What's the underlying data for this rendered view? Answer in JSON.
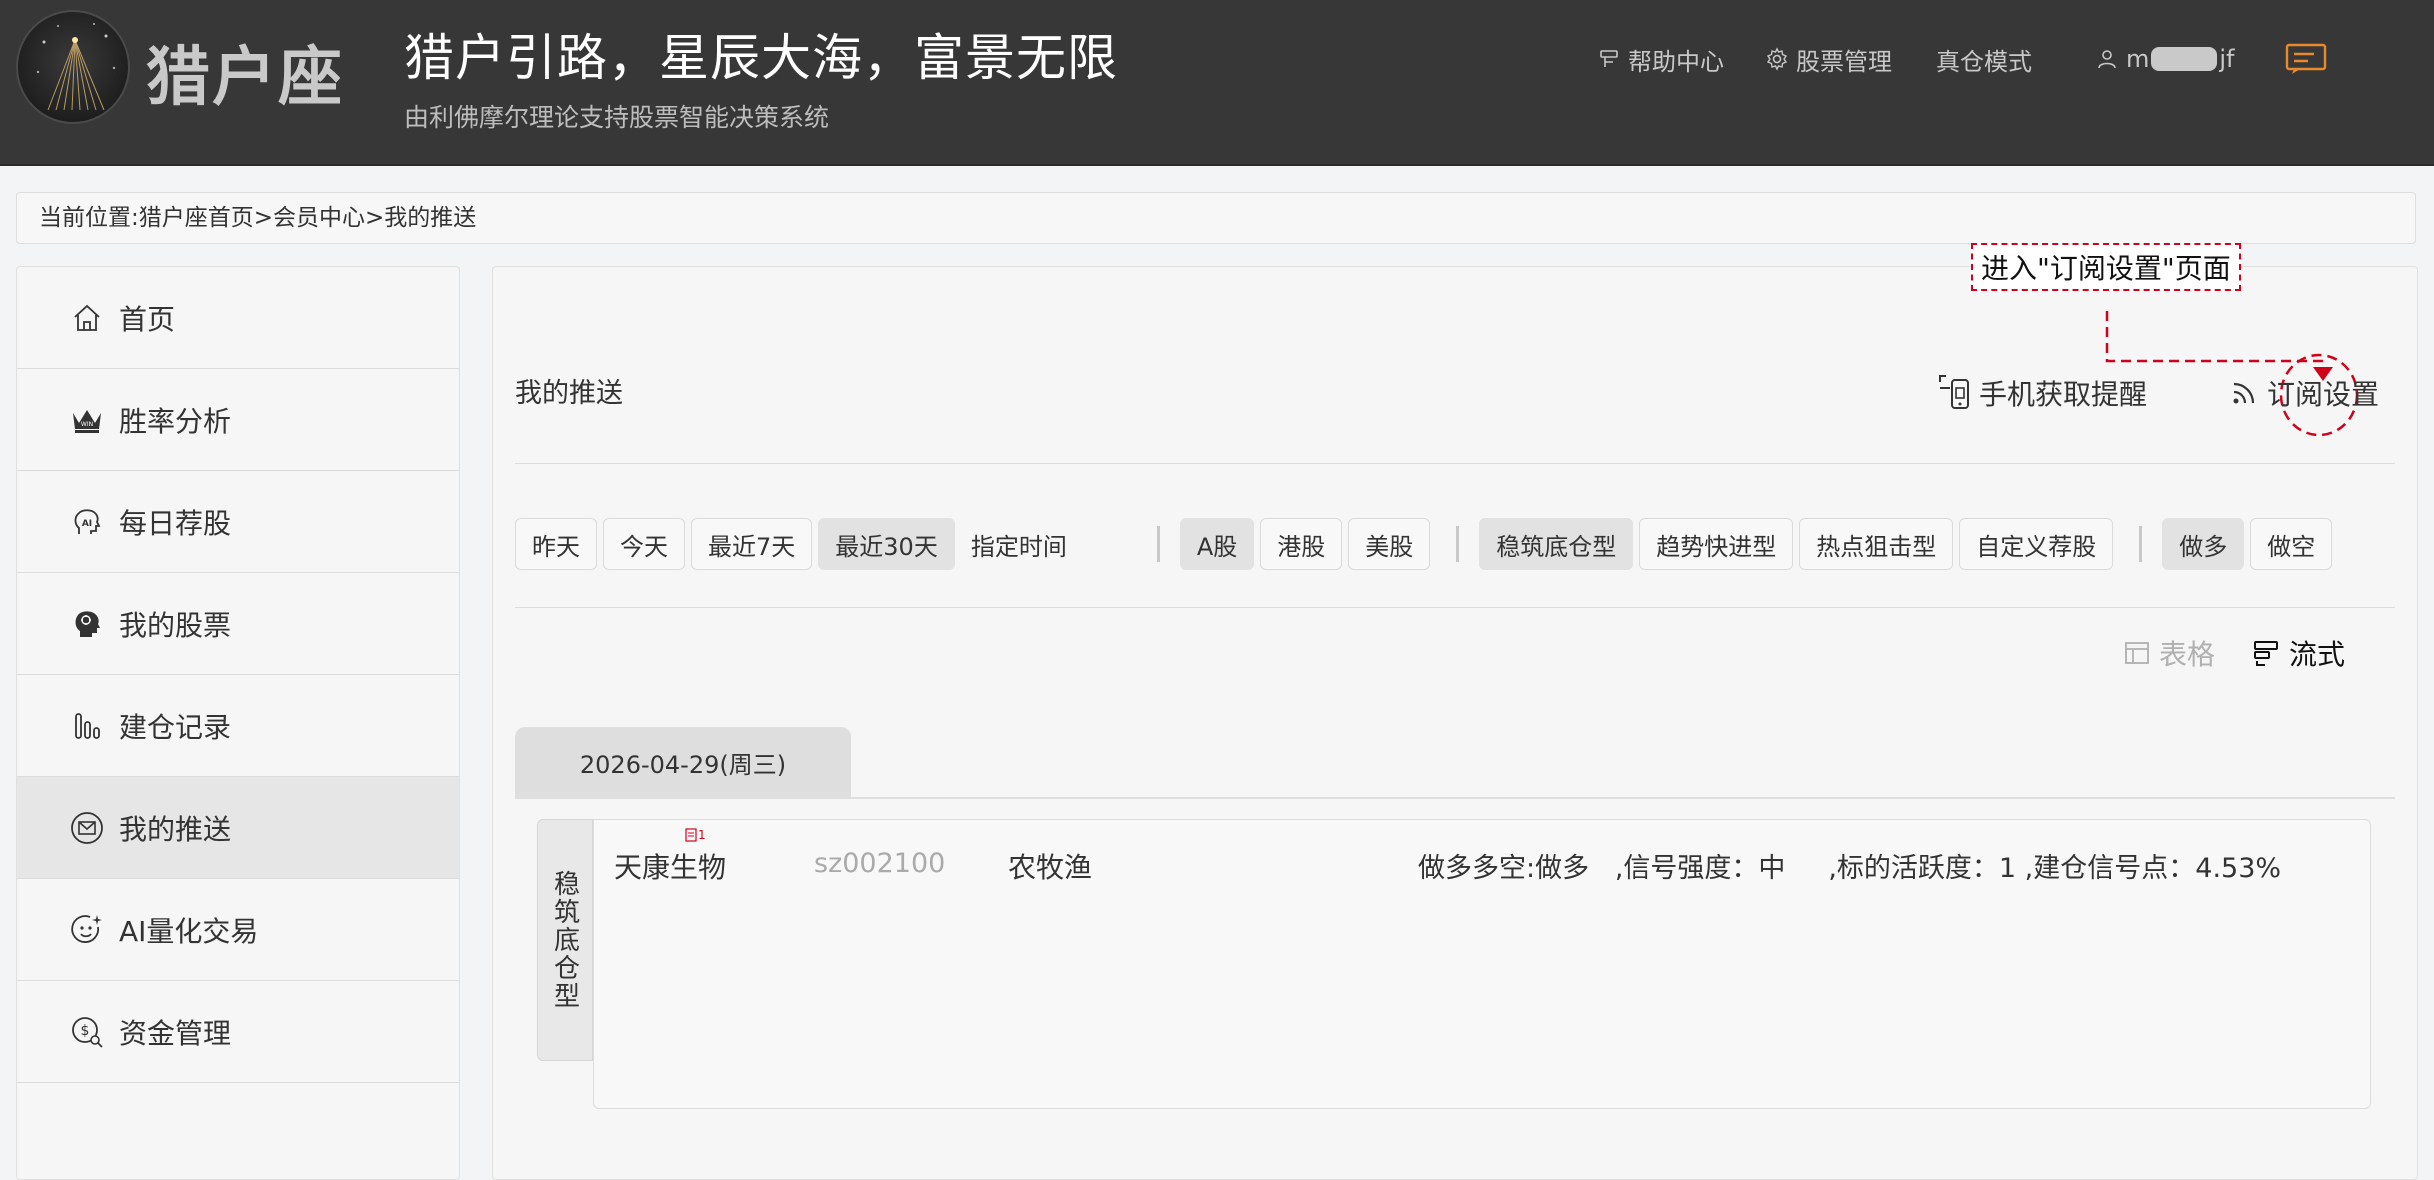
{
  "header": {
    "logo_text": "猎户座",
    "slogan": "猎户引路，星辰大海，富景无限",
    "sub_slogan": "由利佛摩尔理论支持股票智能决策系统",
    "nav": {
      "help": "帮助中心",
      "stock_manage": "股票管理",
      "real_mode": "真仓模式",
      "user_prefix": "m",
      "user_suffix": "jf"
    }
  },
  "breadcrumb": "当前位置:猎户座首页>会员中心>我的推送",
  "sidebar": {
    "items": [
      {
        "label": "首页",
        "icon": "home-icon"
      },
      {
        "label": "胜率分析",
        "icon": "crown-icon"
      },
      {
        "label": "每日荐股",
        "icon": "ai-head-icon"
      },
      {
        "label": "我的股票",
        "icon": "brain-head-icon"
      },
      {
        "label": "建仓记录",
        "icon": "bar-chart-icon"
      },
      {
        "label": "我的推送",
        "icon": "mail-circle-icon"
      },
      {
        "label": "AI量化交易",
        "icon": "smile-spark-icon"
      },
      {
        "label": "资金管理",
        "icon": "money-search-icon"
      }
    ],
    "active_index": 5
  },
  "main": {
    "title": "我的推送",
    "annotation": "进入\"订阅设置\"页面",
    "actions": {
      "mobile": "手机获取提醒",
      "subscribe": "订阅设置"
    },
    "filters": {
      "time": [
        "昨天",
        "今天",
        "最近7天",
        "最近30天"
      ],
      "time_selected": "最近30天",
      "custom_time": "指定时间",
      "market": [
        "A股",
        "港股",
        "美股"
      ],
      "market_selected": "A股",
      "strategy": [
        "稳筑底仓型",
        "趋势快进型",
        "热点狙击型",
        "自定义荐股"
      ],
      "strategy_selected": "稳筑底仓型",
      "direction": [
        "做多",
        "做空"
      ],
      "direction_selected": "做多"
    },
    "view": {
      "table": "表格",
      "flow": "流式",
      "selected": "流式"
    },
    "date_tab": "2026-04-29(周三)",
    "card": {
      "type_label": "稳筑底仓型",
      "badge": "1",
      "name": "天康生物",
      "code": "sz002100",
      "industry": "农牧渔",
      "signal": "做多多空:做多   ,信号强度：中     ,标的活跃度：1 ,建仓信号点：4.53%"
    }
  },
  "colors": {
    "header_bg": "#373737",
    "annotation_red": "#d0021b",
    "accent_orange": "#e8892b"
  }
}
